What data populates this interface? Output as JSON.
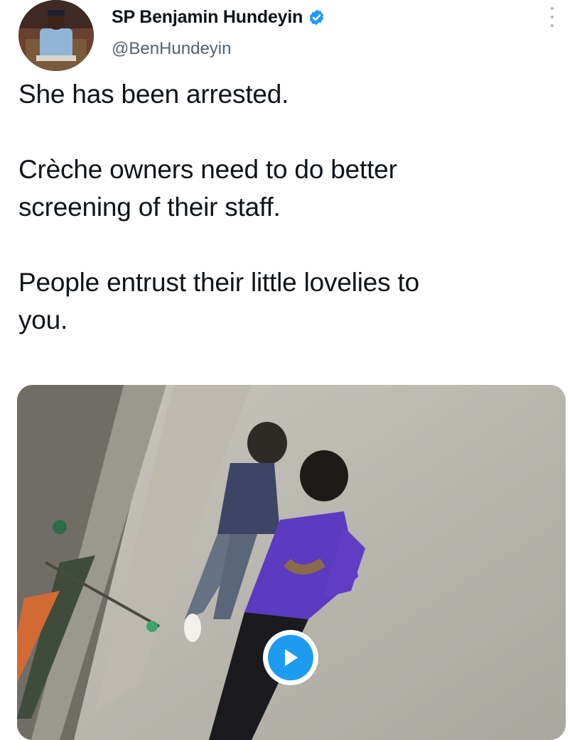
{
  "author": {
    "display_name": "SP Benjamin Hundeyin",
    "handle": "@BenHundeyin",
    "verified": true,
    "avatar_icon": "profile-photo"
  },
  "tweet": {
    "paragraphs": [
      [
        "She has been arrested."
      ],
      [
        "Crèche owners need to do better",
        "screening of their staff."
      ],
      [
        "People entrust their little lovelies to",
        "you."
      ]
    ]
  },
  "media": {
    "type": "video",
    "play_icon": "play-icon"
  },
  "colors": {
    "accent": "#1d9bf0",
    "text": "#0f1419",
    "secondary": "#536471"
  }
}
